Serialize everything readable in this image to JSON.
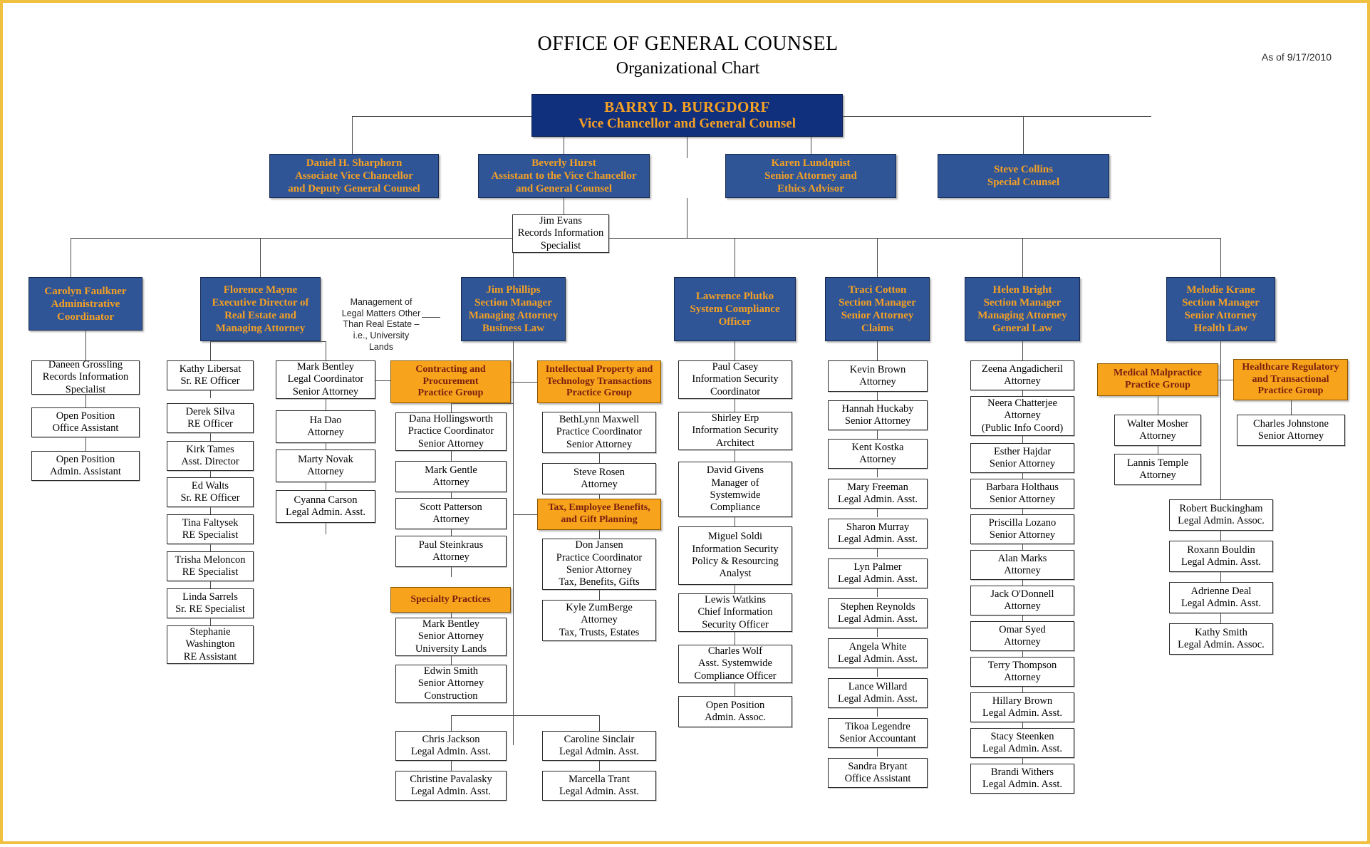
{
  "header": {
    "title": "OFFICE OF GENERAL COUNSEL",
    "subtitle": "Organizational Chart",
    "as_of": "As of 9/17/2010"
  },
  "colors": {
    "navy": "#10307e",
    "blue": "#2f5597",
    "orange": "#f7a31c",
    "gold_text": "#f4a024",
    "orange_text": "#7a1f10",
    "page_border": "#f0c040"
  },
  "executive": {
    "name": "BARRY D. BURGDORF",
    "title": "Vice Chancellor and General Counsel"
  },
  "level2": [
    {
      "name": "Daniel H. Sharphorn",
      "line2": "Associate Vice Chancellor",
      "line3": "and Deputy General Counsel"
    },
    {
      "name": "Beverly Hurst",
      "line2": "Assistant to the Vice Chancellor",
      "line3": "and General Counsel"
    },
    {
      "name": "Karen Lundquist",
      "line2": "Senior Attorney and",
      "line3": "Ethics Advisor"
    },
    {
      "name": "Steve Collins",
      "line2": "Special Counsel",
      "line3": ""
    }
  ],
  "hurst_report": {
    "name": "Jim Evans",
    "line2": "Records Information",
    "line3": "Specialist"
  },
  "note_university_lands": "Management of Legal Matters Other Than Real Estate – i.e., University Lands",
  "departments": [
    {
      "id": "faulkner",
      "name": "Carolyn Faulkner",
      "line2": "Administrative",
      "line3": "Coordinator",
      "line4": ""
    },
    {
      "id": "mayne",
      "name": "Florence Mayne",
      "line2": "Executive Director of",
      "line3": "Real Estate and",
      "line4": "Managing Attorney"
    },
    {
      "id": "phillips",
      "name": "Jim Phillips",
      "line2": "Section Manager",
      "line3": "Managing Attorney",
      "line4": "Business Law"
    },
    {
      "id": "plutko",
      "name": "Lawrence Plutko",
      "line2": "System Compliance",
      "line3": "Officer",
      "line4": ""
    },
    {
      "id": "cotton",
      "name": "Traci Cotton",
      "line2": "Section Manager",
      "line3": "Senior Attorney",
      "line4": "Claims"
    },
    {
      "id": "bright",
      "name": "Helen Bright",
      "line2": "Section Manager",
      "line3": "Managing Attorney",
      "line4": "General Law"
    },
    {
      "id": "krane",
      "name": "Melodie Krane",
      "line2": "Section Manager",
      "line3": "Senior Attorney",
      "line4": "Health Law"
    }
  ],
  "practice_groups": {
    "contracting": {
      "l1": "Contracting and",
      "l2": "Procurement",
      "l3": "Practice Group"
    },
    "specialty": {
      "l1": "Specialty Practices",
      "l2": "",
      "l3": ""
    },
    "ip": {
      "l1": "Intellectual Property and",
      "l2": "Technology Transactions",
      "l3": "Practice Group"
    },
    "tax": {
      "l1": "Tax, Employee Benefits,",
      "l2": "and Gift Planning",
      "l3": ""
    },
    "medmal": {
      "l1": "Medical Malpractice",
      "l2": "Practice Group",
      "l3": ""
    },
    "healthreg": {
      "l1": "Healthcare Regulatory",
      "l2": "and Transactional",
      "l3": "Practice Group"
    }
  },
  "staff": {
    "faulkner": [
      {
        "l1": "Daneen Grossling",
        "l2": "Records Information",
        "l3": "Specialist"
      },
      {
        "l1": "Open Position",
        "l2": "Office Assistant",
        "l3": ""
      },
      {
        "l1": "Open Position",
        "l2": "Admin. Assistant",
        "l3": ""
      }
    ],
    "mayne_re": [
      {
        "l1": "Kathy Libersat",
        "l2": "Sr. RE Officer",
        "l3": ""
      },
      {
        "l1": "Derek Silva",
        "l2": "RE Officer",
        "l3": ""
      },
      {
        "l1": "Kirk Tames",
        "l2": "Asst. Director",
        "l3": ""
      },
      {
        "l1": "Ed Walts",
        "l2": "Sr. RE Officer",
        "l3": ""
      },
      {
        "l1": "Tina Faltysek",
        "l2": "RE Specialist",
        "l3": ""
      },
      {
        "l1": "Trisha Meloncon",
        "l2": "RE Specialist",
        "l3": ""
      },
      {
        "l1": "Linda Sarrels",
        "l2": "Sr. RE Specialist",
        "l3": ""
      },
      {
        "l1": "Stephanie",
        "l2": "Washington",
        "l3": "RE Assistant"
      }
    ],
    "mayne_legal": [
      {
        "l1": "Mark Bentley",
        "l2": "Legal Coordinator",
        "l3": "Senior Attorney"
      },
      {
        "l1": "Ha Dao",
        "l2": "Attorney",
        "l3": ""
      },
      {
        "l1": "Marty Novak",
        "l2": "Attorney",
        "l3": ""
      },
      {
        "l1": "Cyanna Carson",
        "l2": "Legal Admin. Asst.",
        "l3": ""
      }
    ],
    "contracting": [
      {
        "l1": "Dana Hollingsworth",
        "l2": "Practice Coordinator",
        "l3": "Senior Attorney"
      },
      {
        "l1": "Mark Gentle",
        "l2": "Attorney",
        "l3": ""
      },
      {
        "l1": "Scott Patterson",
        "l2": "Attorney",
        "l3": ""
      },
      {
        "l1": "Paul Steinkraus",
        "l2": "Attorney",
        "l3": ""
      }
    ],
    "specialty": [
      {
        "l1": "Mark Bentley",
        "l2": "Senior Attorney",
        "l3": "University Lands"
      },
      {
        "l1": "Edwin Smith",
        "l2": "Senior Attorney",
        "l3": "Construction"
      }
    ],
    "ip": [
      {
        "l1": "BethLynn Maxwell",
        "l2": "Practice Coordinator",
        "l3": "Senior Attorney"
      },
      {
        "l1": "Steve Rosen",
        "l2": "Attorney",
        "l3": ""
      }
    ],
    "tax": [
      {
        "l1": "Don Jansen",
        "l2": "Practice Coordinator",
        "l3": "Senior Attorney",
        "l4": "Tax, Benefits, Gifts"
      },
      {
        "l1": "Kyle ZumBerge",
        "l2": "Attorney",
        "l3": "Tax, Trusts, Estates"
      }
    ],
    "businesslaw_admin_left": [
      {
        "l1": "Chris Jackson",
        "l2": "Legal Admin. Asst.",
        "l3": ""
      },
      {
        "l1": "Christine Pavalasky",
        "l2": "Legal Admin. Asst.",
        "l3": ""
      }
    ],
    "businesslaw_admin_right": [
      {
        "l1": "Caroline Sinclair",
        "l2": "Legal Admin. Asst.",
        "l3": ""
      },
      {
        "l1": "Marcella Trant",
        "l2": "Legal Admin. Asst.",
        "l3": ""
      }
    ],
    "plutko": [
      {
        "l1": "Paul Casey",
        "l2": "Information Security",
        "l3": "Coordinator"
      },
      {
        "l1": "Shirley Erp",
        "l2": "Information Security",
        "l3": "Architect"
      },
      {
        "l1": "David Givens",
        "l2": "Manager of",
        "l3": "Systemwide",
        "l4": "Compliance"
      },
      {
        "l1": "Miguel Soldi",
        "l2": "Information Security",
        "l3": "Policy & Resourcing",
        "l4": "Analyst"
      },
      {
        "l1": "Lewis Watkins",
        "l2": "Chief Information",
        "l3": "Security Officer"
      },
      {
        "l1": "Charles Wolf",
        "l2": "Asst. Systemwide",
        "l3": "Compliance Officer"
      },
      {
        "l1": "Open Position",
        "l2": "Admin. Assoc.",
        "l3": ""
      }
    ],
    "cotton": [
      {
        "l1": "Kevin Brown",
        "l2": "Attorney",
        "l3": ""
      },
      {
        "l1": "Hannah Huckaby",
        "l2": "Senior Attorney",
        "l3": ""
      },
      {
        "l1": "Kent Kostka",
        "l2": "Attorney",
        "l3": ""
      },
      {
        "l1": "Mary Freeman",
        "l2": "Legal Admin. Asst.",
        "l3": ""
      },
      {
        "l1": "Sharon Murray",
        "l2": "Legal Admin. Asst.",
        "l3": ""
      },
      {
        "l1": "Lyn Palmer",
        "l2": "Legal Admin. Asst.",
        "l3": ""
      },
      {
        "l1": "Stephen Reynolds",
        "l2": "Legal Admin. Asst.",
        "l3": ""
      },
      {
        "l1": "Angela White",
        "l2": "Legal Admin. Asst.",
        "l3": ""
      },
      {
        "l1": "Lance Willard",
        "l2": "Legal Admin. Asst.",
        "l3": ""
      },
      {
        "l1": "Tikoa Legendre",
        "l2": "Senior Accountant",
        "l3": ""
      },
      {
        "l1": "Sandra Bryant",
        "l2": "Office Assistant",
        "l3": ""
      }
    ],
    "bright": [
      {
        "l1": "Zeena Angadicheril",
        "l2": "Attorney",
        "l3": ""
      },
      {
        "l1": "Neera Chatterjee",
        "l2": "Attorney",
        "l3": "(Public Info Coord)"
      },
      {
        "l1": "Esther Hajdar",
        "l2": "Senior Attorney",
        "l3": ""
      },
      {
        "l1": "Barbara Holthaus",
        "l2": "Senior Attorney",
        "l3": ""
      },
      {
        "l1": "Priscilla Lozano",
        "l2": "Senior Attorney",
        "l3": ""
      },
      {
        "l1": "Alan Marks",
        "l2": "Attorney",
        "l3": ""
      },
      {
        "l1": "Jack O'Donnell",
        "l2": "Attorney",
        "l3": ""
      },
      {
        "l1": "Omar Syed",
        "l2": "Attorney",
        "l3": ""
      },
      {
        "l1": "Terry Thompson",
        "l2": "Attorney",
        "l3": ""
      },
      {
        "l1": "Hillary Brown",
        "l2": "Legal Admin. Asst.",
        "l3": ""
      },
      {
        "l1": "Stacy Steenken",
        "l2": "Legal Admin. Asst.",
        "l3": ""
      },
      {
        "l1": "Brandi Withers",
        "l2": "Legal Admin. Asst.",
        "l3": ""
      }
    ],
    "medmal": [
      {
        "l1": "Walter Mosher",
        "l2": "Attorney",
        "l3": ""
      },
      {
        "l1": "Lannis Temple",
        "l2": "Attorney",
        "l3": ""
      }
    ],
    "healthreg": [
      {
        "l1": "Charles Johnstone",
        "l2": "Senior Attorney",
        "l3": ""
      }
    ],
    "krane_admin": [
      {
        "l1": "Robert Buckingham",
        "l2": "Legal Admin. Assoc.",
        "l3": ""
      },
      {
        "l1": "Roxann Bouldin",
        "l2": "Legal Admin. Asst.",
        "l3": ""
      },
      {
        "l1": "Adrienne Deal",
        "l2": "Legal Admin. Asst.",
        "l3": ""
      },
      {
        "l1": "Kathy Smith",
        "l2": "Legal Admin. Assoc.",
        "l3": ""
      }
    ]
  }
}
